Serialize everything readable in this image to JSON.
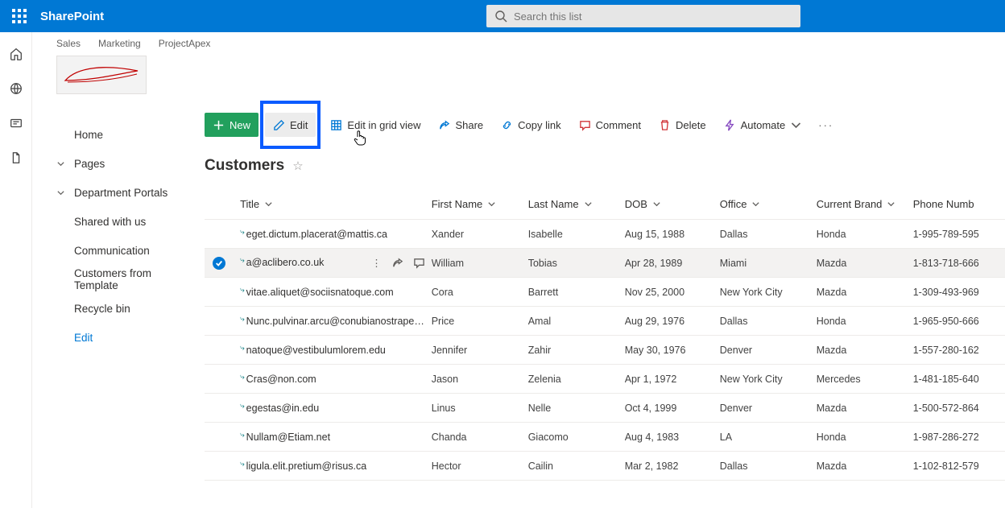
{
  "header": {
    "appName": "SharePoint",
    "searchPlaceholder": "Search this list"
  },
  "hub": [
    "Sales",
    "Marketing",
    "ProjectApex"
  ],
  "leftnav": {
    "home": "Home",
    "pages": "Pages",
    "dept": "Department Portals",
    "shared": "Shared with us",
    "comm": "Communication",
    "cust": "Customers from Template",
    "recycle": "Recycle bin",
    "edit": "Edit"
  },
  "commands": {
    "new": "New",
    "edit": "Edit",
    "grid": "Edit in grid view",
    "share": "Share",
    "copy": "Copy link",
    "comment": "Comment",
    "delete": "Delete",
    "automate": "Automate"
  },
  "list": {
    "title": "Customers"
  },
  "columns": {
    "title": "Title",
    "firstName": "First Name",
    "lastName": "Last Name",
    "dob": "DOB",
    "office": "Office",
    "brand": "Current Brand",
    "phone": "Phone Numb"
  },
  "rows": [
    {
      "title": "eget.dictum.placerat@mattis.ca",
      "fn": "Xander",
      "ln": "Isabelle",
      "dob": "Aug 15, 1988",
      "off": "Dallas",
      "brand": "Honda",
      "phone": "1-995-789-595",
      "sel": false
    },
    {
      "title": "a@aclibero.co.uk",
      "fn": "William",
      "ln": "Tobias",
      "dob": "Apr 28, 1989",
      "off": "Miami",
      "brand": "Mazda",
      "phone": "1-813-718-666",
      "sel": true
    },
    {
      "title": "vitae.aliquet@sociisnatoque.com",
      "fn": "Cora",
      "ln": "Barrett",
      "dob": "Nov 25, 2000",
      "off": "New York City",
      "brand": "Mazda",
      "phone": "1-309-493-969",
      "sel": false
    },
    {
      "title": "Nunc.pulvinar.arcu@conubianostraper.edu",
      "fn": "Price",
      "ln": "Amal",
      "dob": "Aug 29, 1976",
      "off": "Dallas",
      "brand": "Honda",
      "phone": "1-965-950-666",
      "sel": false
    },
    {
      "title": "natoque@vestibulumlorem.edu",
      "fn": "Jennifer",
      "ln": "Zahir",
      "dob": "May 30, 1976",
      "off": "Denver",
      "brand": "Mazda",
      "phone": "1-557-280-162",
      "sel": false
    },
    {
      "title": "Cras@non.com",
      "fn": "Jason",
      "ln": "Zelenia",
      "dob": "Apr 1, 1972",
      "off": "New York City",
      "brand": "Mercedes",
      "phone": "1-481-185-640",
      "sel": false
    },
    {
      "title": "egestas@in.edu",
      "fn": "Linus",
      "ln": "Nelle",
      "dob": "Oct 4, 1999",
      "off": "Denver",
      "brand": "Mazda",
      "phone": "1-500-572-864",
      "sel": false
    },
    {
      "title": "Nullam@Etiam.net",
      "fn": "Chanda",
      "ln": "Giacomo",
      "dob": "Aug 4, 1983",
      "off": "LA",
      "brand": "Honda",
      "phone": "1-987-286-272",
      "sel": false
    },
    {
      "title": "ligula.elit.pretium@risus.ca",
      "fn": "Hector",
      "ln": "Cailin",
      "dob": "Mar 2, 1982",
      "off": "Dallas",
      "brand": "Mazda",
      "phone": "1-102-812-579",
      "sel": false
    }
  ]
}
